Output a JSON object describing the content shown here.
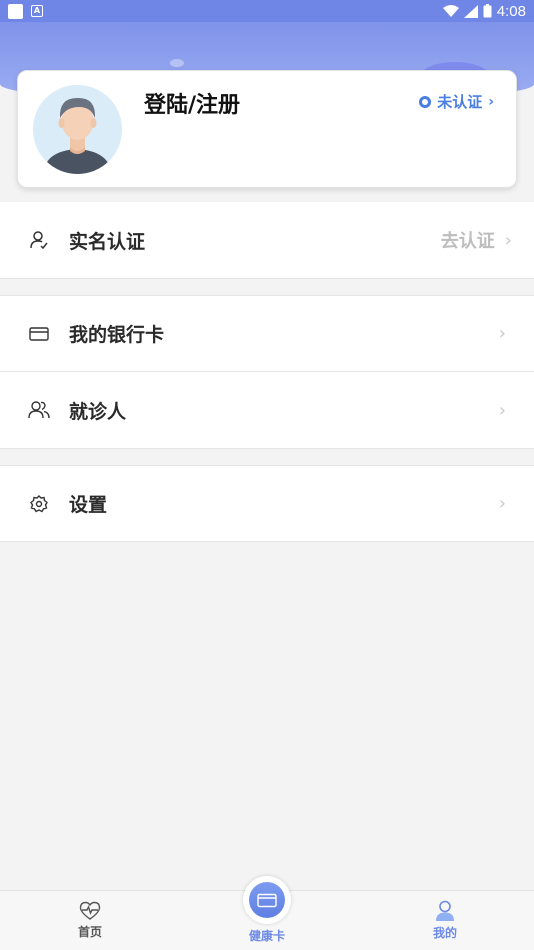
{
  "status_bar": {
    "time": "4:08",
    "icons": [
      "notification-square-icon",
      "a-badge-icon",
      "wifi-icon",
      "signal-icon",
      "battery-icon"
    ]
  },
  "profile": {
    "login_label": "登陆/注册",
    "verify_status": "未认证",
    "avatar_icon": "user-avatar"
  },
  "menu": {
    "real_name": {
      "label": "实名认证",
      "action": "去认证",
      "icon": "user-check-icon"
    },
    "bank_card": {
      "label": "我的银行卡",
      "icon": "card-icon"
    },
    "patient": {
      "label": "就诊人",
      "icon": "users-icon"
    },
    "settings": {
      "label": "设置",
      "icon": "gear-icon"
    }
  },
  "bottom_nav": {
    "home": "首页",
    "health_card": "健康卡",
    "mine": "我的"
  },
  "colors": {
    "accent": "#6d8ae6",
    "header": "#7f93ea",
    "verify": "#4a7ee0"
  }
}
